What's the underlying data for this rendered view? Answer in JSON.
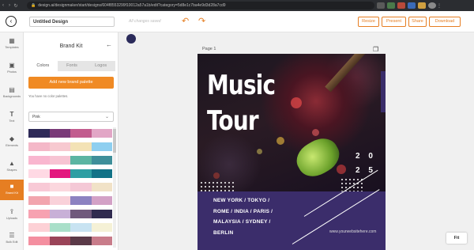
{
  "browser": {
    "back_icon": "arrow-left-icon",
    "forward_icon": "arrow-right-icon",
    "reload_icon": "reload-icon",
    "url": "design.ai/designmaker/start/designs/604f8553299f10012a57a1b/edit?category=5d8e1c7ba4e9d3d28a7cd9"
  },
  "topbar": {
    "logo_icon": "back-circle-icon",
    "design_title": "Untitled Design",
    "save_status": "All changes saved",
    "undo_icon": "undo-icon",
    "redo_icon": "redo-icon",
    "buttons": [
      "Resize",
      "Present",
      "Share",
      "Download"
    ]
  },
  "iconbar": {
    "items": [
      {
        "label": "Templates",
        "icon": "templates-icon"
      },
      {
        "label": "Photos",
        "icon": "photos-icon"
      },
      {
        "label": "Backgrounds",
        "icon": "backgrounds-icon"
      },
      {
        "label": "Text",
        "icon": "text-icon"
      },
      {
        "label": "Elements",
        "icon": "elements-icon"
      },
      {
        "label": "Shapes",
        "icon": "shapes-icon"
      },
      {
        "label": "Brand Kit",
        "icon": "brand-kit-icon"
      },
      {
        "label": "Uploads",
        "icon": "uploads-icon"
      },
      {
        "label": "Bulk Edit",
        "icon": "bulk-edit-icon"
      }
    ],
    "active": "Brand Kit"
  },
  "panel": {
    "title": "Brand Kit",
    "close_icon": "arrow-left-icon",
    "tabs": [
      "Colors",
      "Fonts",
      "Logos"
    ],
    "active_tab": "Colors",
    "add_button": "Add new brand palette",
    "empty_message": "You have no color palettes.",
    "palette_select": "Pink",
    "swatch_rows": [
      [
        "#2e2a58",
        "#7a3a78",
        "#c25c8e",
        "#e2a6c6"
      ],
      [
        "#f4b8c8",
        "#f7c9d0",
        "#f3e2b5",
        "#8ecff0"
      ],
      [
        "#f9b6cf",
        "#f7c4d3",
        "#5bb5a2",
        "#3f8f9a"
      ],
      [
        "#ffd9e4",
        "#e3177e",
        "#2e9ea3",
        "#127287"
      ],
      [
        "#f8c9d6",
        "#fbd7de",
        "#f4c8d6",
        "#f1e2c7"
      ],
      [
        "#f2a5ae",
        "#f9d1d9",
        "#8c82c1",
        "#d3a1c6"
      ],
      [
        "#f7a2b1",
        "#c8b0d7",
        "#70597c",
        "#302b4f"
      ],
      [
        "#fdd1d6",
        "#a9dfc9",
        "#c8e3f2",
        "#f5f1d6"
      ],
      [
        "#f48fa0",
        "#9a4458",
        "#5b3a48",
        "#c87c8a"
      ]
    ]
  },
  "canvas": {
    "page_label": "Page 1",
    "copy_icon": "duplicate-page-icon",
    "fit_label": "Fit"
  },
  "design": {
    "title_line1": "Music",
    "title_line2": "Tour",
    "year_line1": "2 0",
    "year_line2": "2 5",
    "cities": [
      "NEW YORK / TOKYO /",
      "ROME / INDIA / PARIS /",
      "MALAYSIA / SYDNEY /",
      "BERLIN"
    ],
    "website": "www.yourwebsitehere.com",
    "colors": {
      "band": "#3b2d6b",
      "accent": "#e67e22"
    }
  }
}
